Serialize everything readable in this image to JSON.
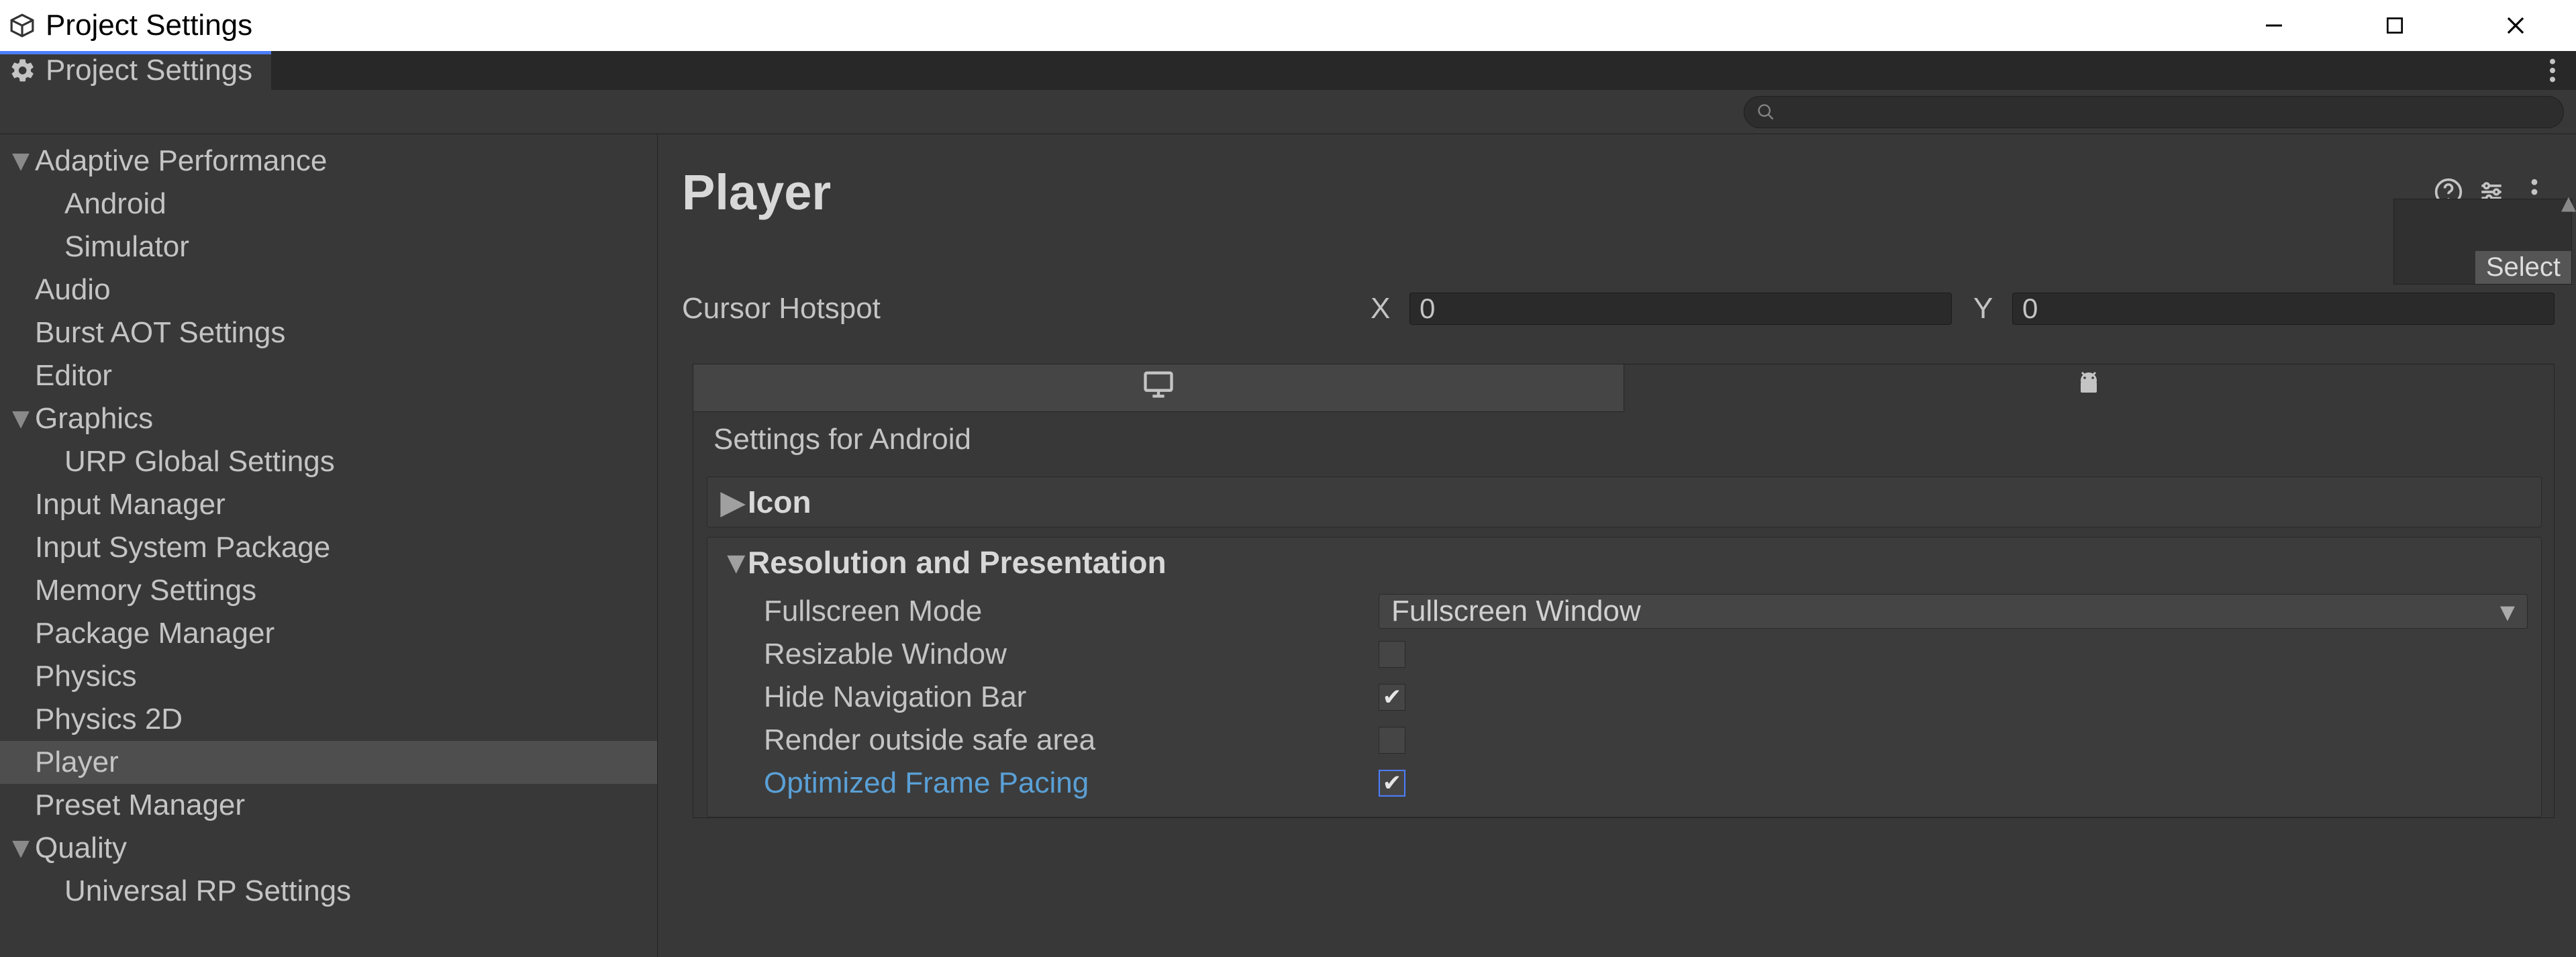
{
  "window": {
    "title": "Project Settings"
  },
  "tab": {
    "label": "Project Settings"
  },
  "search": {
    "placeholder": ""
  },
  "sidebar": {
    "items": [
      {
        "label": "Adaptive Performance",
        "expandable": true,
        "expanded": true
      },
      {
        "label": "Android",
        "child": true
      },
      {
        "label": "Simulator",
        "child": true
      },
      {
        "label": "Audio"
      },
      {
        "label": "Burst AOT Settings"
      },
      {
        "label": "Editor"
      },
      {
        "label": "Graphics",
        "expandable": true,
        "expanded": true
      },
      {
        "label": "URP Global Settings",
        "child": true
      },
      {
        "label": "Input Manager"
      },
      {
        "label": "Input System Package"
      },
      {
        "label": "Memory Settings"
      },
      {
        "label": "Package Manager"
      },
      {
        "label": "Physics"
      },
      {
        "label": "Physics 2D"
      },
      {
        "label": "Player",
        "selected": true
      },
      {
        "label": "Preset Manager"
      },
      {
        "label": "Quality",
        "expandable": true,
        "expanded": true
      },
      {
        "label": "Universal RP Settings",
        "child": true
      }
    ]
  },
  "panel": {
    "title": "Player",
    "select_label": "Select",
    "cursor_hotspot": {
      "label": "Cursor Hotspot",
      "x_label": "X",
      "x_value": "0",
      "y_label": "Y",
      "y_value": "0"
    },
    "platform_section_title": "Settings for Android",
    "groups": {
      "icon": {
        "title": "Icon",
        "expanded": false
      },
      "resolution": {
        "title": "Resolution and Presentation",
        "expanded": true,
        "fields": {
          "fullscreen_mode": {
            "label": "Fullscreen Mode",
            "value": "Fullscreen Window"
          },
          "resizable_window": {
            "label": "Resizable Window",
            "checked": false
          },
          "hide_nav_bar": {
            "label": "Hide Navigation Bar",
            "checked": true
          },
          "render_outside_safe": {
            "label": "Render outside safe area",
            "checked": false
          },
          "optimized_frame_pacing": {
            "label": "Optimized Frame Pacing",
            "checked": true,
            "highlighted": true
          }
        }
      }
    }
  }
}
